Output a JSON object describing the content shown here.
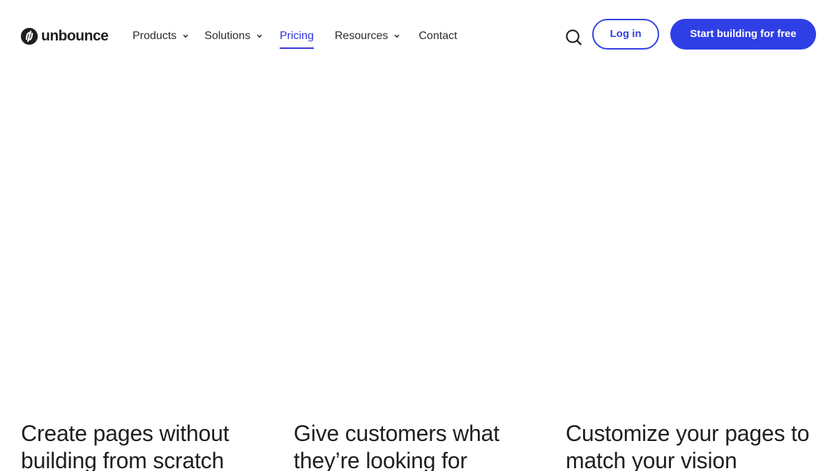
{
  "header": {
    "logo_text": "unbounce",
    "nav": [
      {
        "label": "Products",
        "has_dropdown": true
      },
      {
        "label": "Solutions",
        "has_dropdown": true
      },
      {
        "label": "Pricing",
        "has_dropdown": false,
        "active": true
      },
      {
        "label": "Resources",
        "has_dropdown": true
      },
      {
        "label": "Contact",
        "has_dropdown": false
      }
    ],
    "search_icon": "search-icon",
    "login_label": "Log in",
    "cta_label": "Start building for free"
  },
  "features": [
    {
      "title": "Create pages without building from scratch"
    },
    {
      "title": "Give customers what they’re looking for"
    },
    {
      "title": "Customize your pages to match your vision"
    }
  ],
  "colors": {
    "accent": "#2f3fe6",
    "active_nav": "#3333dd",
    "text": "#1f1f1f",
    "background": "#ffffff"
  }
}
